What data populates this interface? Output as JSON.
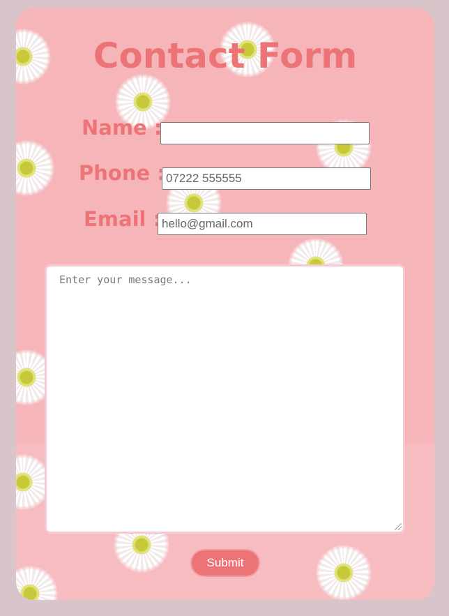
{
  "form": {
    "title": "Contact Form",
    "name_label": "Name :",
    "name_value": "",
    "phone_label": "Phone :",
    "phone_value": "07222 555555",
    "email_label": "Email :",
    "email_value": "hello@gmail.com",
    "message_placeholder": "Enter your message...",
    "submit_label": "Submit"
  },
  "colors": {
    "page_background": "#d8c5c9",
    "card_background": "#f6b6b9",
    "accent": "#ec7477",
    "message_border": "#f9c9d1"
  }
}
